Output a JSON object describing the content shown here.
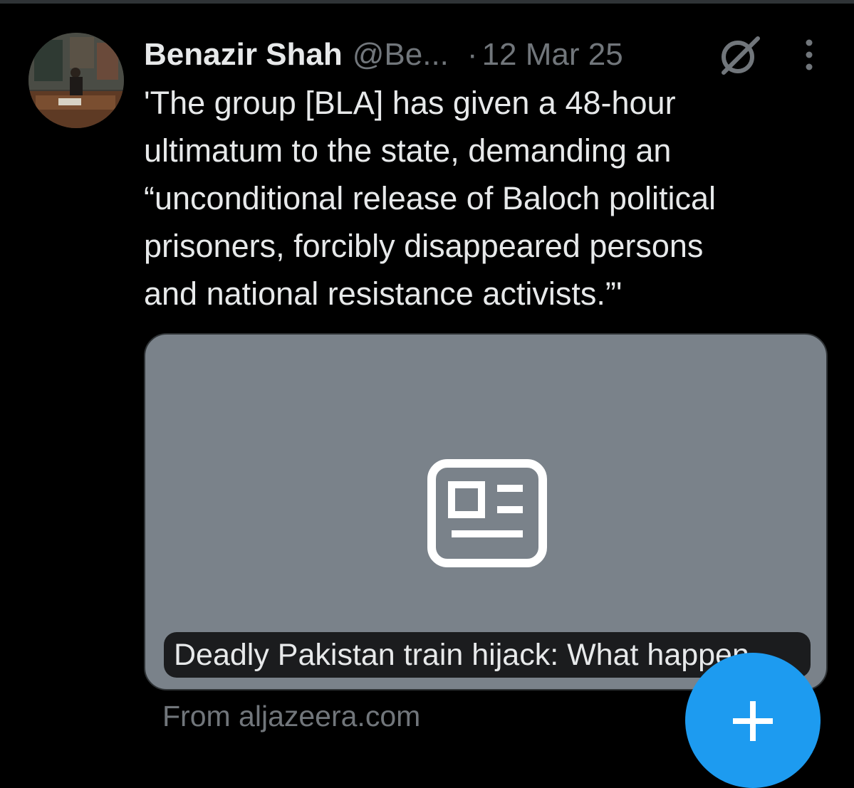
{
  "tweet": {
    "author_name": "Benazir Shah",
    "author_handle": "@Be...",
    "separator": "·",
    "date": "12 Mar 25",
    "text": "'The group [BLA] has given a 48-hour\nultimatum to the state, demanding an\n“unconditional release of Baloch political\nprisoners, forcibly disappeared persons\nand national resistance activists.”'",
    "avatar_icon": "profile-photo",
    "grok_icon": "grok-icon",
    "more_icon": "more-vertical-icon"
  },
  "link_card": {
    "placeholder_icon": "news-article-icon",
    "title": "Deadly Pakistan train hijack: What happen...",
    "source": "From aljazeera.com"
  },
  "compose_fab": {
    "icon": "plus-icon"
  },
  "colors": {
    "background": "#000000",
    "text_primary": "#e7e9ea",
    "text_secondary": "#71767b",
    "card_background": "#7a828a",
    "accent": "#1d9bf0"
  }
}
